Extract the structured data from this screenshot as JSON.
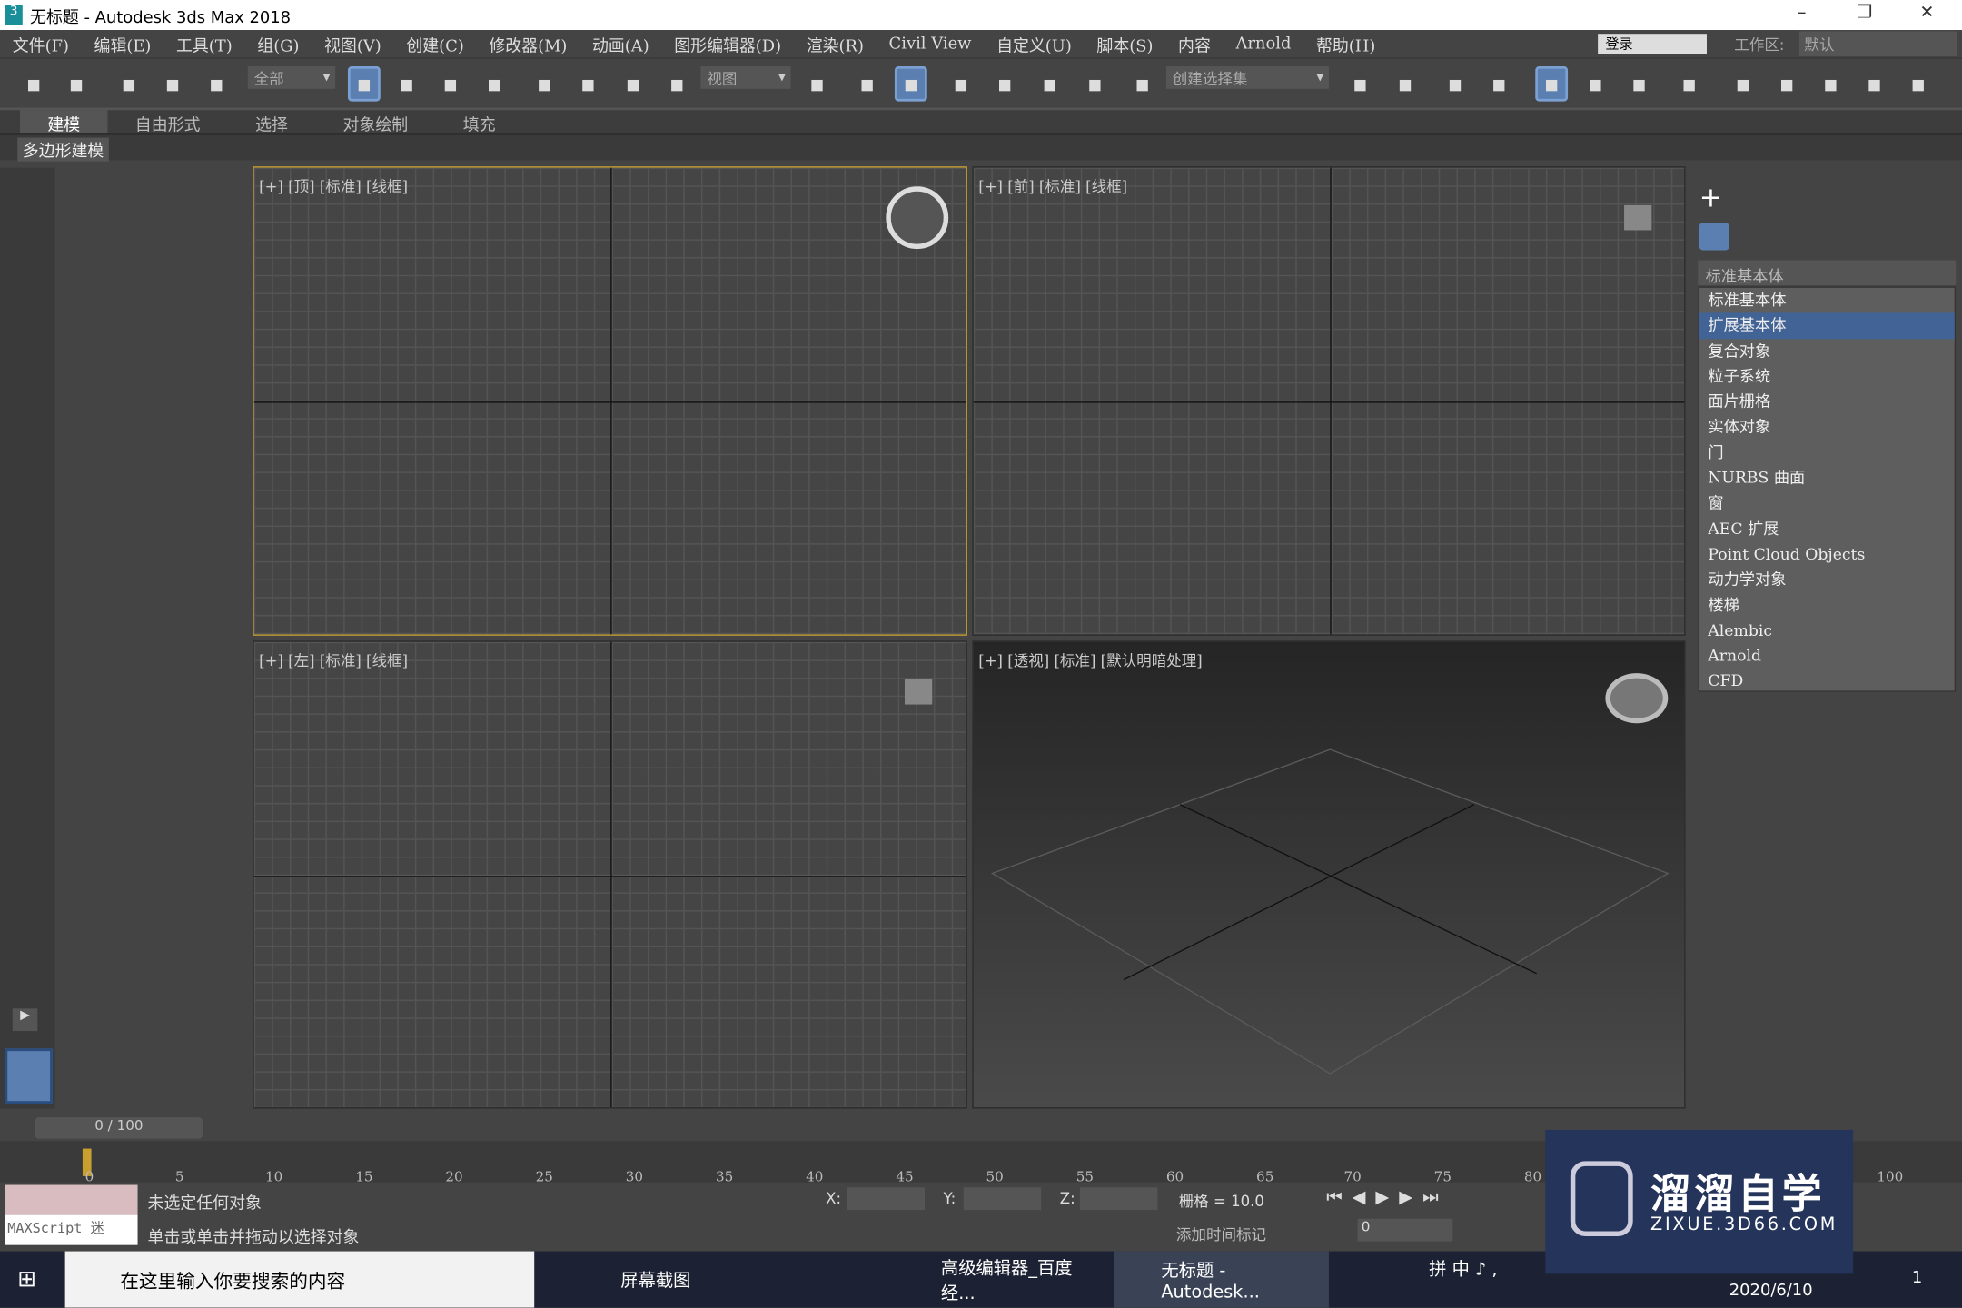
{
  "window": {
    "title": "无标题 - Autodesk 3ds Max 2018",
    "logo": "3",
    "min": "–",
    "restore": "❐",
    "close": "✕"
  },
  "menu": [
    "文件(F)",
    "编辑(E)",
    "工具(T)",
    "组(G)",
    "视图(V)",
    "创建(C)",
    "修改器(M)",
    "动画(A)",
    "图形编辑器(D)",
    "渲染(R)",
    "Civil View",
    "自定义(U)",
    "脚本(S)",
    "内容",
    "Arnold",
    "帮助(H)"
  ],
  "login": "登录",
  "workspace": {
    "label": "工作区:",
    "value": "默认"
  },
  "toolbar": {
    "filter": "全部",
    "refcoord": "视图",
    "selset": "创建选择集",
    "icons": [
      "undo-icon",
      "redo-icon",
      "link-icon",
      "unlink-icon",
      "bind-spacewarp-icon",
      "select-object-icon",
      "select-by-name-icon",
      "rect-select-region-icon",
      "window-crossing-icon",
      "move-icon",
      "rotate-icon",
      "scale-icon",
      "place-icon",
      "pivot-icon",
      "mirror-axis-icon",
      "keyboard-shortcut-override-icon",
      "snap-3d-icon",
      "angle-snap-icon",
      "percent-snap-icon",
      "spinner-snap-icon",
      "named-selection-icon",
      "mirror-icon",
      "align-icon",
      "scene-explorer-icon",
      "layer-explorer-icon",
      "ribbon-toggle-icon",
      "curve-editor-icon",
      "schematic-view-icon",
      "material-editor-icon",
      "render-setup-icon",
      "rendered-frame-icon",
      "render-icon",
      "render-cloud-icon",
      "render-iterative-icon"
    ]
  },
  "ribbon": {
    "tabs": [
      "建模",
      "自由形式",
      "选择",
      "对象绘制",
      "填充"
    ],
    "sub": "多边形建模"
  },
  "viewports": {
    "top": "[+] [顶] [标准] [线框]",
    "front": "[+] [前] [标准] [线框]",
    "left": "[+] [左] [标准] [线框]",
    "persp": "[+] [透视] [标准] [默认明暗处理]"
  },
  "command_panel": {
    "selected": "标准基本体",
    "items": [
      "标准基本体",
      "扩展基本体",
      "复合对象",
      "粒子系统",
      "面片栅格",
      "实体对象",
      "门",
      "NURBS 曲面",
      "窗",
      "AEC 扩展",
      "Point Cloud Objects",
      "动力学对象",
      "楼梯",
      "Alembic",
      "Arnold",
      "CFD"
    ],
    "highlighted": 1
  },
  "timeline": {
    "frame": "0 / 100",
    "ticks": [
      "0",
      "5",
      "10",
      "15",
      "20",
      "25",
      "30",
      "35",
      "40",
      "45",
      "50",
      "55",
      "60",
      "65",
      "70",
      "75",
      "80",
      "100"
    ]
  },
  "status": {
    "maxscript": "MAXScript 迷",
    "line1": "未选定任何对象",
    "line2": "单击或单击并拖动以选择对象",
    "x": "X:",
    "y": "Y:",
    "z": "Z:",
    "grid": "栅格 = 10.0",
    "add_time_tag": "添加时间标记",
    "frame_value": "0"
  },
  "taskbar": {
    "search": "在这里输入你要搜索的内容",
    "apps": [
      "屏幕截图",
      "高级编辑器_百度经...",
      "无标题 - Autodesk..."
    ],
    "ime": "拼 中 ♪ ,",
    "date": "2020/6/10",
    "notif": "1"
  },
  "watermark": {
    "name": "溜溜自学",
    "url": "ZIXUE.3D66.COM"
  },
  "colors": {
    "accent": "#5b7fb0",
    "highlight": "#416396",
    "selected_viewport": "#c8a030"
  }
}
